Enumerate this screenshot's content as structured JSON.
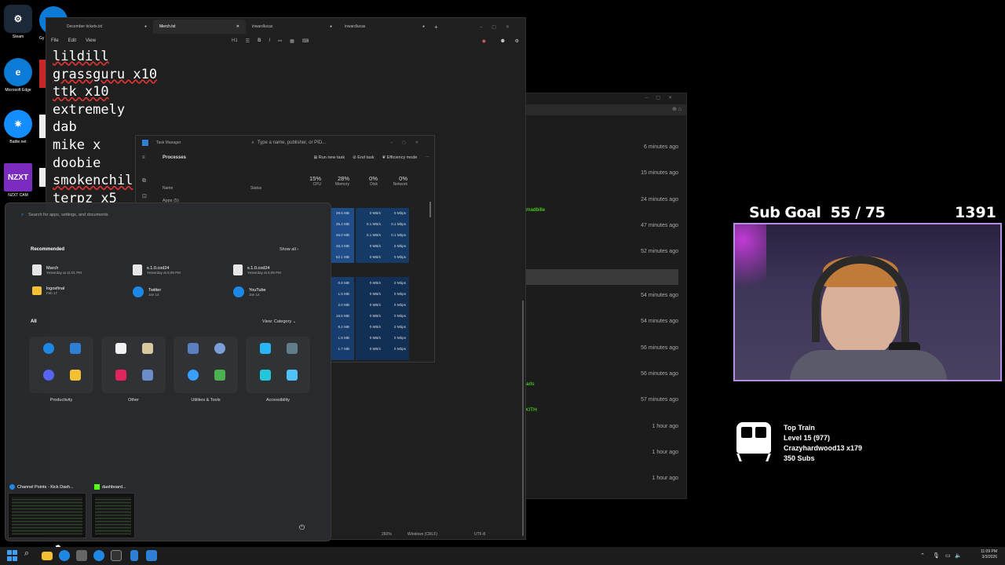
{
  "desktop": {
    "icons": [
      {
        "label": "Steam",
        "color": "#1b2838"
      },
      {
        "label": "Microsoft Edge",
        "color": "#0c7bd6"
      },
      {
        "label": "Battle.net",
        "color": "#148eff"
      },
      {
        "label": "NZXT CAM",
        "color": "#7b2cbf"
      }
    ],
    "partial_labels": [
      "Gy"
    ]
  },
  "notepad": {
    "tabs": [
      {
        "label": "December tickets.txt"
      },
      {
        "label": "Merch.txt"
      },
      {
        "label": "inwardlucas"
      },
      {
        "label": "inwardlucas"
      }
    ],
    "menu": [
      "File",
      "Edit",
      "View"
    ],
    "toolbar": [
      "H1",
      "☰",
      "B",
      "I",
      "⚯",
      "▦",
      "⌨"
    ],
    "lines": [
      {
        "text": "lildill",
        "spell": true
      },
      {
        "text": "grassguru x10",
        "spell": true
      },
      {
        "text": "ttk x10",
        "spell": true
      },
      {
        "text": "extremely",
        "spell": false
      },
      {
        "text": "dab",
        "spell": false
      },
      {
        "text": "mike x",
        "spell": false
      },
      {
        "text": "doobie",
        "spell": false
      },
      {
        "text": "smokenchil",
        "spell": true
      },
      {
        "text": "terpz x5",
        "spell": false
      }
    ],
    "status": {
      "zoom": "260%",
      "line_ending": "Windows (CRLF)",
      "encoding": "UTF-8"
    }
  },
  "background_window": {
    "times": [
      "6 minutes ago",
      "15 minutes ago",
      "24 minutes ago",
      "47 minutes ago",
      "52 minutes ago",
      "54 minutes ago",
      "54 minutes ago",
      "56 minutes ago",
      "56 minutes ago",
      "57 minutes ago",
      "1 hour ago",
      "1 hour ago",
      "1 hour ago"
    ],
    "green_texts": [
      "madbille",
      "arls",
      "XITH"
    ]
  },
  "task_manager": {
    "title": "Task Manager",
    "search_placeholder": "Type a name, publisher, or PID...",
    "section": "Processes",
    "actions": [
      "Run new task",
      "End task",
      "Efficiency mode"
    ],
    "columns": {
      "name": "Name",
      "status": "Status",
      "cpu": {
        "pct": "15%",
        "label": "CPU"
      },
      "memory": {
        "pct": "28%",
        "label": "Memory"
      },
      "disk": {
        "pct": "0%",
        "label": "Disk"
      },
      "network": {
        "pct": "0%",
        "label": "Network"
      }
    },
    "group": "Apps (5)",
    "rows": [
      [
        "39.6 MB",
        "0 MB/s",
        "0 Mbps"
      ],
      [
        "35.4 MB",
        "0.1 MB/s",
        "0.1 Mbps"
      ],
      [
        "46.0 MB",
        "0.1 MB/s",
        "0.1 Mbps"
      ],
      [
        "48.3 MB",
        "0 MB/s",
        "0 Mbps"
      ],
      [
        "62.1 MB",
        "0 MB/s",
        "0 Mbps"
      ],
      [
        "0.8 MB",
        "0 MB/s",
        "0 Mbps"
      ],
      [
        "1.5 MB",
        "0 MB/s",
        "0 Mbps"
      ],
      [
        "2.0 MB",
        "0 MB/s",
        "0 Mbps"
      ],
      [
        "16.5 MB",
        "0 MB/s",
        "0 Mbps"
      ],
      [
        "8.2 MB",
        "0 MB/s",
        "0 Mbps"
      ],
      [
        "1.6 MB",
        "0 MB/s",
        "0 Mbps"
      ],
      [
        "1.7 MB",
        "0 MB/s",
        "0 Mbps"
      ]
    ]
  },
  "start_menu": {
    "search_placeholder": "Search for apps, settings, and documents",
    "recommended": "Recommended",
    "show_all": "Show all",
    "rec_items": [
      {
        "name": "March",
        "date": "Yesterday at 11:01 PM",
        "color": "#e6e6e6"
      },
      {
        "name": "s.1.0.cod24",
        "date": "Yesterday at 6:09 PM",
        "color": "#e6e6e6"
      },
      {
        "name": "s.1.0.cod24",
        "date": "Yesterday at 6:09 PM",
        "color": "#e6e6e6"
      },
      {
        "name": "logosfinal",
        "date": "Feb 17",
        "color": "#f2c035"
      },
      {
        "name": "Twitter",
        "date": "Jan 14",
        "color": "#1e88e5"
      },
      {
        "name": "YouTube",
        "date": "Jan 14",
        "color": "#1e88e5"
      }
    ],
    "all": "All",
    "view_label": "View: Category",
    "categories": [
      "Productivity",
      "Other",
      "Utilities & Tools",
      "Accessibility"
    ],
    "thumbnails": [
      {
        "title": "Channel Points - Kick Dash..."
      },
      {
        "title": "dashboard..."
      }
    ]
  },
  "stream_overlay": {
    "sub_goal": "Sub Goal  55 / 75",
    "sub_count": "1391",
    "train": {
      "title": "Top Train",
      "level": "Level 15  (977)",
      "user": "Crazyhardwood13 x179",
      "subs": "350 Subs"
    }
  },
  "taskbar": {
    "time": "11:09 PM",
    "date": "3/3/2026"
  }
}
